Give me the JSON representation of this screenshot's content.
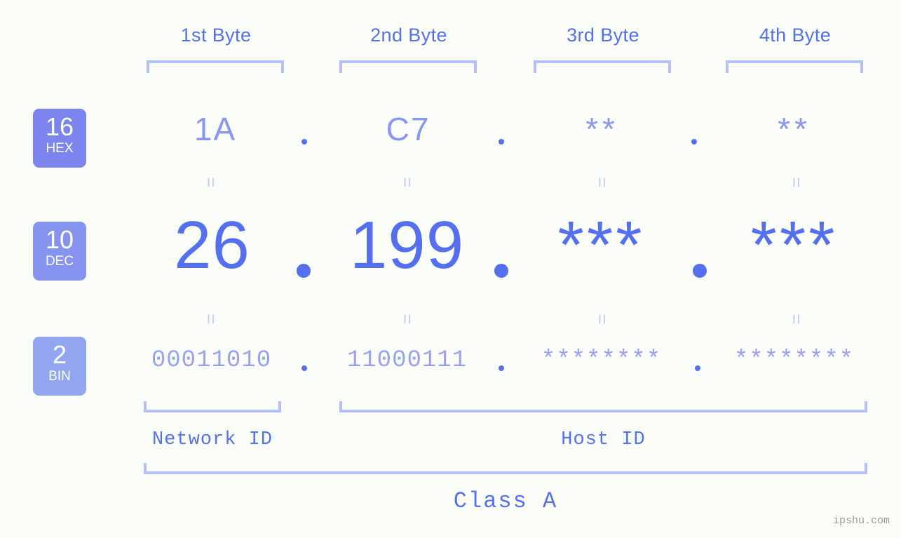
{
  "watermark": "ipshu.com",
  "headers": [
    {
      "label": "1st Byte"
    },
    {
      "label": "2nd Byte"
    },
    {
      "label": "3rd Byte"
    },
    {
      "label": "4th Byte"
    }
  ],
  "bases": [
    {
      "num": "16",
      "name": "HEX",
      "color": "#7b85ed"
    },
    {
      "num": "10",
      "name": "DEC",
      "color": "#8794ef"
    },
    {
      "num": "2",
      "name": "BIN",
      "color": "#92a5f0"
    }
  ],
  "rows": {
    "hex": {
      "base_num": "16",
      "base_name": "HEX",
      "values": [
        "1A",
        "C7",
        "**",
        "**"
      ],
      "separator": "."
    },
    "dec": {
      "base_num": "10",
      "base_name": "DEC",
      "values": [
        "26",
        "199",
        "***",
        "***"
      ],
      "separator": "."
    },
    "bin": {
      "base_num": "2",
      "base_name": "BIN",
      "values": [
        "00011010",
        "11000111",
        "********",
        "********"
      ],
      "separator": "."
    }
  },
  "connector": "=",
  "segments": {
    "network_id": "Network ID",
    "host_id": "Host ID",
    "class": "Class A"
  },
  "colors": {
    "background": "#fbfdf8",
    "hex_text": "#8b96ee",
    "dec_text": "#5570ef",
    "bin_text": "#96a2f0",
    "bracket": "#b4c0f7",
    "header_text": "#5570ef",
    "connector": "#c3cdf8",
    "watermark": "#9a9a9a"
  }
}
